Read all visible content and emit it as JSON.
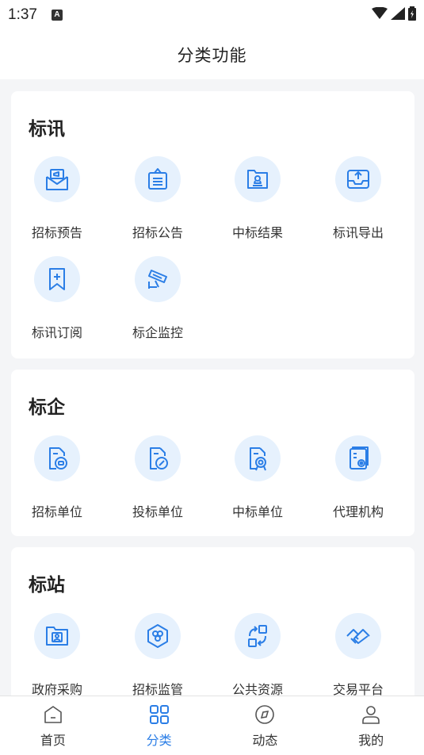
{
  "status": {
    "time": "1:37",
    "notification_letter": "A"
  },
  "header": {
    "title": "分类功能"
  },
  "sections": [
    {
      "title": "标讯",
      "items": [
        {
          "label": "招标预告",
          "icon": "envelope-notice-icon"
        },
        {
          "label": "招标公告",
          "icon": "announcement-board-icon"
        },
        {
          "label": "中标结果",
          "icon": "folder-seal-icon"
        },
        {
          "label": "标讯导出",
          "icon": "export-tray-icon"
        },
        {
          "label": "标讯订阅",
          "icon": "bookmark-plus-icon"
        },
        {
          "label": "标企监控",
          "icon": "camera-monitor-icon"
        }
      ]
    },
    {
      "title": "标企",
      "items": [
        {
          "label": "招标单位",
          "icon": "doc-chat-icon"
        },
        {
          "label": "投标单位",
          "icon": "doc-pen-icon"
        },
        {
          "label": "中标单位",
          "icon": "doc-award-icon"
        },
        {
          "label": "代理机构",
          "icon": "doc-agent-icon"
        }
      ]
    },
    {
      "title": "标站",
      "items": [
        {
          "label": "政府采购",
          "icon": "folder-person-icon"
        },
        {
          "label": "招标监管",
          "icon": "hexagon-cluster-icon"
        },
        {
          "label": "公共资源",
          "icon": "exchange-arrows-icon"
        },
        {
          "label": "交易平台",
          "icon": "handshake-icon"
        }
      ]
    }
  ],
  "tabs": [
    {
      "label": "首页",
      "icon": "home-icon",
      "active": false
    },
    {
      "label": "分类",
      "icon": "grid-icon",
      "active": true
    },
    {
      "label": "动态",
      "icon": "compass-icon",
      "active": false
    },
    {
      "label": "我的",
      "icon": "user-icon",
      "active": false
    }
  ],
  "colors": {
    "accent": "#2b7ee6",
    "icon_bg": "#e6f1fd",
    "page_bg": "#f4f5f7"
  }
}
